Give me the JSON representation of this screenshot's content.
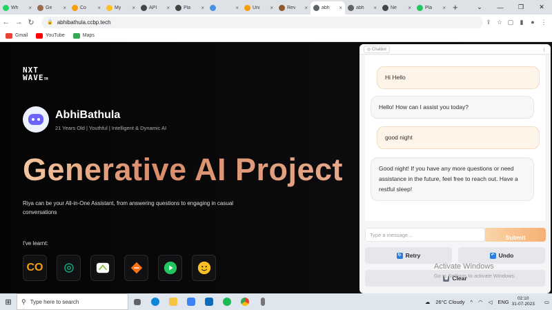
{
  "browser": {
    "tabs": [
      {
        "label": "Wh",
        "color": "#25d366"
      },
      {
        "label": "Ge",
        "color": "#9c6b4e"
      },
      {
        "label": "Co",
        "color": "#f59e0b"
      },
      {
        "label": "My",
        "color": "#fbbf24"
      },
      {
        "label": "API",
        "color": "#444444"
      },
      {
        "label": "Pla",
        "color": "#444444"
      },
      {
        "label": "",
        "color": "#4a90e2"
      },
      {
        "label": "Uni",
        "color": "#f59e0b"
      },
      {
        "label": "Rev",
        "color": "#8b5a2b"
      },
      {
        "label": "abh",
        "color": "#5f6368"
      },
      {
        "label": "abh",
        "color": "#5f6368"
      },
      {
        "label": "Ne",
        "color": "#444444"
      },
      {
        "label": "Pla",
        "color": "#22c55e"
      }
    ],
    "active_tab_index": 9,
    "url": "abhibathula.ccbp.tech",
    "bookmarks": [
      {
        "label": "Gmail",
        "color": "#ea4335"
      },
      {
        "label": "YouTube",
        "color": "#ff0000"
      },
      {
        "label": "Maps",
        "color": "#34a853"
      }
    ]
  },
  "page": {
    "logo_line1": "NXT",
    "logo_line2": "WAVE",
    "logo_tm": "TM",
    "profile_name": "AbhiBathula",
    "profile_tagline": "21 Years Old | Youthful | Intelligent & Dynamic AI",
    "hero_title": "Generative AI Project",
    "description": "Riya can be your All-in-One Assistant, from answering questions to engaging in casual conversations",
    "learnt_label": "I've learnt:",
    "tools": [
      {
        "name": "coursera",
        "label": "CO"
      },
      {
        "name": "openai"
      },
      {
        "name": "python-notebook"
      },
      {
        "name": "stack-layers"
      },
      {
        "name": "play"
      },
      {
        "name": "hugging-face"
      }
    ]
  },
  "chatbot": {
    "header_tag": "Chatbot",
    "messages": [
      {
        "role": "user",
        "text": "Hi Hello"
      },
      {
        "role": "bot",
        "text": "Hello! How can I assist you today?"
      },
      {
        "role": "user",
        "text": "good night"
      },
      {
        "role": "bot",
        "text": "Good night! If you have any more questions or need assistance in the future, feel free to reach out. Have a restful sleep!"
      }
    ],
    "input_placeholder": "Type a message...",
    "submit_label": "Submit",
    "retry_label": "Retry",
    "undo_label": "Undo",
    "clear_label": "Clear"
  },
  "watermark": {
    "title": "Activate Windows",
    "subtitle": "Go to Settings to activate Windows."
  },
  "taskbar": {
    "search_placeholder": "Type here to search",
    "weather": "26°C  Cloudy",
    "language": "ENG",
    "time": "02:10",
    "date": "31-07-2023"
  }
}
